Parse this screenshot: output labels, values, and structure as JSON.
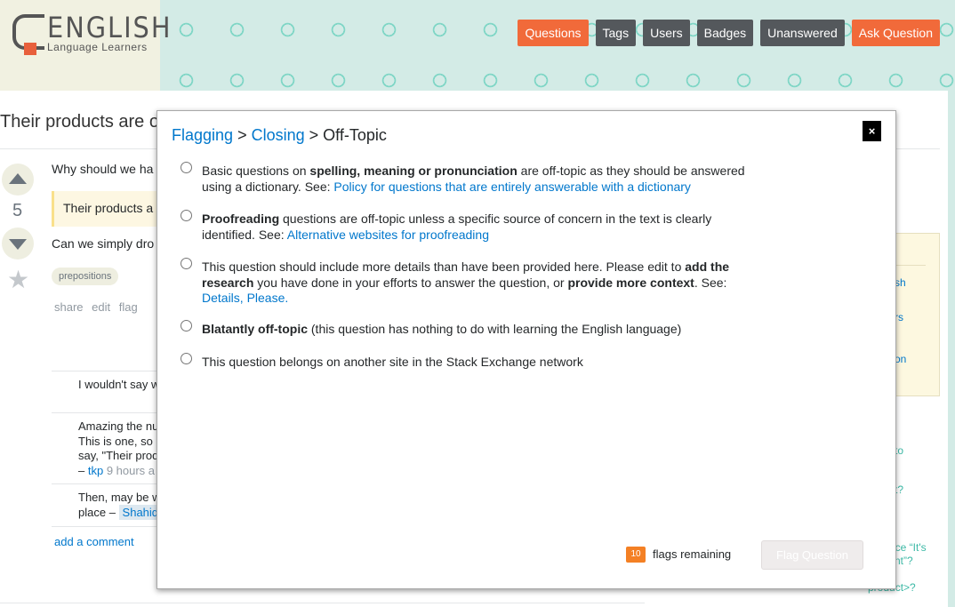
{
  "site": {
    "logo_title": "ENGLISH",
    "logo_subtitle": "Language Learners"
  },
  "nav": [
    {
      "label": "Questions"
    },
    {
      "label": "Tags"
    },
    {
      "label": "Users"
    },
    {
      "label": "Badges"
    },
    {
      "label": "Unanswered"
    },
    {
      "label": "Ask Question"
    }
  ],
  "colors": {
    "accent": "#f16a3a",
    "nav_dark": "#54585c",
    "link": "#0077cc"
  },
  "question": {
    "title": "Their products are o",
    "vote_count": "5",
    "body_1": "Why should we ha",
    "quote": "Their products a",
    "body_2": "Can we simply dro",
    "tag": "prepositions",
    "menu": [
      "share",
      "edit",
      "flag"
    ]
  },
  "comments": [
    {
      "lines": [
        "I wouldn't say w"
      ]
    },
    {
      "lines": [
        "Amazing the nu",
        "This is one, so",
        "say, \"Their prod"
      ],
      "user": "tkp",
      "time": "9 hours a"
    },
    {
      "lines": [
        "Then, may be w"
      ],
      "prefix": "place –",
      "user": "Shahid"
    }
  ],
  "add_comment": "add a comment",
  "sidebar": {
    "box_links": [
      "sh",
      "rs",
      "on"
    ],
    "related": [
      "to",
      "t?",
      "nce “It's",
      "nt”?",
      "product>?"
    ]
  },
  "modal": {
    "breadcrumb": [
      "Flagging",
      "Closing",
      "Off-Topic"
    ],
    "separator": ">",
    "close_label": "×",
    "options": [
      {
        "pre": "Basic questions on ",
        "bold": "spelling, meaning or pronunciation",
        "post": " are off-topic as they should be answered using a dictionary. See: ",
        "link": "Policy for questions that are entirely answerable with a dictionary"
      },
      {
        "bold": "Proofreading",
        "post": " questions are off-topic unless a specific source of concern in the text is clearly identified. See: ",
        "link": "Alternative websites for proofreading"
      },
      {
        "pre": "This question should include more details than have been provided here. Please edit to ",
        "bold": "add the research",
        "mid": " you have done in your efforts to answer the question, or ",
        "bold2": "provide more context",
        "post": ". See: ",
        "link": "Details, Please."
      },
      {
        "bold": "Blatantly off-topic",
        "post": " (this question has nothing to do with learning the English language)"
      },
      {
        "pre": "This question belongs on another site in the Stack Exchange network"
      }
    ],
    "flags_count": "10",
    "flags_label": "flags remaining",
    "submit": "Flag Question"
  }
}
